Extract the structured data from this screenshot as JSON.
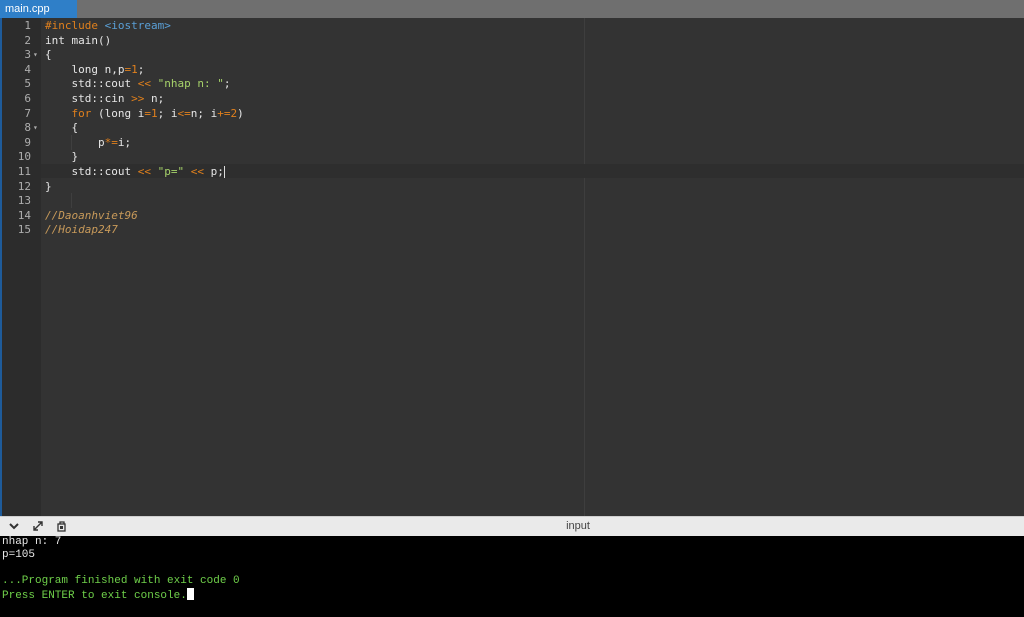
{
  "tab": {
    "label": "main.cpp"
  },
  "editor": {
    "lines": [
      {
        "n": "1",
        "fold": "",
        "tokens": [
          [
            "kw-pre",
            "#include "
          ],
          [
            "kw-inc",
            "<iostream>"
          ]
        ]
      },
      {
        "n": "2",
        "fold": "",
        "tokens": [
          [
            "",
            "int main()"
          ]
        ]
      },
      {
        "n": "3",
        "fold": "▾",
        "tokens": [
          [
            "",
            "{"
          ]
        ]
      },
      {
        "n": "4",
        "fold": "",
        "tokens": [
          [
            "",
            "    long n,p"
          ],
          [
            "op",
            "="
          ],
          [
            "num",
            "1"
          ],
          [
            "",
            ";"
          ]
        ]
      },
      {
        "n": "5",
        "fold": "",
        "tokens": [
          [
            "",
            "    std::cout "
          ],
          [
            "op",
            "<<"
          ],
          [
            "",
            " "
          ],
          [
            "str",
            "\"nhap n: \""
          ],
          [
            "",
            ";"
          ]
        ]
      },
      {
        "n": "6",
        "fold": "",
        "tokens": [
          [
            "",
            "    std::cin "
          ],
          [
            "op",
            ">>"
          ],
          [
            "",
            " n;"
          ]
        ]
      },
      {
        "n": "7",
        "fold": "",
        "tokens": [
          [
            "kw",
            "    for"
          ],
          [
            "",
            " (long i"
          ],
          [
            "op",
            "="
          ],
          [
            "num",
            "1"
          ],
          [
            "",
            "; i"
          ],
          [
            "op",
            "<="
          ],
          [
            "",
            "n; i"
          ],
          [
            "op",
            "+="
          ],
          [
            "num",
            "2"
          ],
          [
            "",
            ")"
          ]
        ]
      },
      {
        "n": "8",
        "fold": "▾",
        "tokens": [
          [
            "",
            "    {"
          ]
        ]
      },
      {
        "n": "9",
        "fold": "",
        "tokens": [
          [
            "",
            "        p"
          ],
          [
            "op",
            "*="
          ],
          [
            "",
            "i;"
          ]
        ]
      },
      {
        "n": "10",
        "fold": "",
        "tokens": [
          [
            "",
            "    }"
          ]
        ]
      },
      {
        "n": "11",
        "fold": "",
        "tokens": [
          [
            "",
            "    std::cout "
          ],
          [
            "op",
            "<<"
          ],
          [
            "",
            " "
          ],
          [
            "str",
            "\"p=\""
          ],
          [
            "",
            " "
          ],
          [
            "op",
            "<<"
          ],
          [
            "",
            " p;"
          ]
        ],
        "cursor": true
      },
      {
        "n": "12",
        "fold": "",
        "tokens": [
          [
            "",
            "}"
          ]
        ]
      },
      {
        "n": "13",
        "fold": "",
        "tokens": []
      },
      {
        "n": "14",
        "fold": "",
        "tokens": [
          [
            "cmt",
            "//Daoanhviet96"
          ]
        ]
      },
      {
        "n": "15",
        "fold": "",
        "tokens": [
          [
            "cmt",
            "//Hoidap247"
          ]
        ]
      }
    ]
  },
  "console": {
    "title": "input",
    "icons": [
      "chevron-down-icon",
      "expand-icon",
      "copy-icon"
    ],
    "output": [
      {
        "text": "nhap n: 7",
        "style": "white"
      },
      {
        "text": "p=105",
        "style": "white"
      },
      {
        "text": "",
        "style": "white"
      },
      {
        "text": "...Program finished with exit code 0",
        "style": "green"
      },
      {
        "text": "Press ENTER to exit console.",
        "style": "green",
        "cursor": true
      }
    ]
  }
}
